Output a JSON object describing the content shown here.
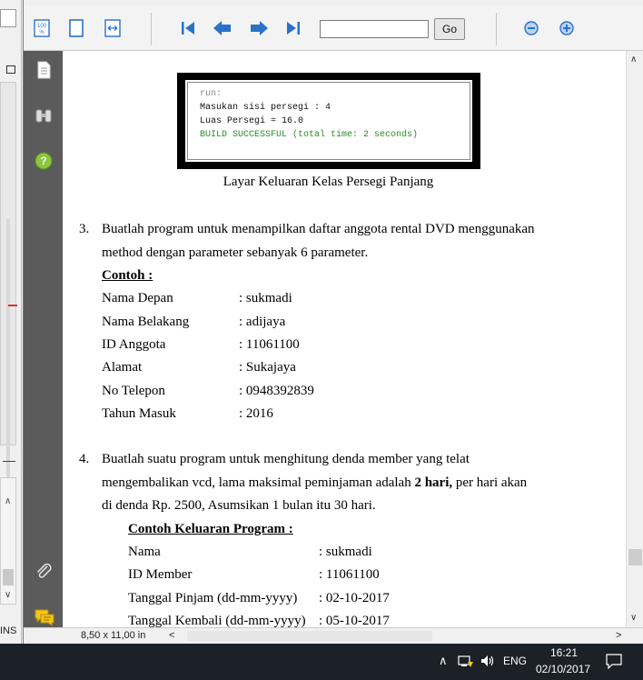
{
  "toolbar": {
    "page_input_value": "",
    "go_label": "Go"
  },
  "status_bar": {
    "page_size": "8,50 x 11,00 in"
  },
  "background_window": {
    "ins_label": "INS"
  },
  "document": {
    "console_output": {
      "line1": "run:",
      "line2": "Masukan sisi persegi : 4",
      "line3": "Luas Persegi = 16.0",
      "line4": "BUILD SUCCESSFUL (total time: 2 seconds)"
    },
    "figure_caption": "Layar Keluaran Kelas Persegi Panjang",
    "item3": {
      "number": "3.",
      "line1": "Buatlah program untuk menampilkan daftar anggota rental DVD menggunakan",
      "line2": "method dengan parameter sebanyak 6 parameter.",
      "heading": "Contoh :",
      "rows": [
        {
          "label": "Nama Depan",
          "value": ": sukmadi"
        },
        {
          "label": "Nama Belakang",
          "value": ": adijaya"
        },
        {
          "label": "ID Anggota",
          "value": ": 11061100"
        },
        {
          "label": "Alamat",
          "value": ": Sukajaya"
        },
        {
          "label": "No Telepon",
          "value": ": 0948392839"
        },
        {
          "label": "Tahun Masuk",
          "value": ": 2016"
        }
      ]
    },
    "item4": {
      "number": "4.",
      "line1": "Buatlah suatu program untuk menghitung denda member yang telat",
      "line2_pre": "mengembalikan vcd, lama maksimal peminjaman adalah ",
      "line2_bold": "2 hari,",
      "line2_post": " per hari akan",
      "line3": "di denda Rp. 2500, Asumsikan 1 bulan itu 30 hari.",
      "heading": "Contoh Keluaran Program :",
      "rows": [
        {
          "label": "Nama",
          "value": ": sukmadi"
        },
        {
          "label": "ID Member",
          "value": ": 11061100"
        },
        {
          "label": "Tanggal Pinjam (dd-mm-yyyy)",
          "value": ": 02-10-2017"
        },
        {
          "label": "Tanggal Kembali (dd-mm-yyyy)",
          "value": ": 05-10-2017"
        }
      ]
    }
  },
  "taskbar": {
    "language": "ENG",
    "time": "16:21",
    "date": "02/10/2017"
  },
  "colors": {
    "sidebar": "#5b5b5b",
    "nav_arrow": "#2a72c8",
    "console_success": "#2a8a2a"
  }
}
